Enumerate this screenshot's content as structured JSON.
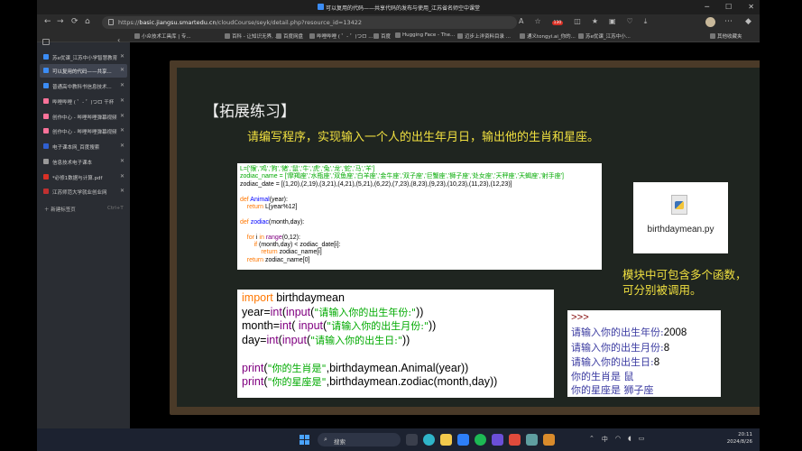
{
  "window": {
    "title": "可以复用的代码——共享代码的发布与使用_江苏省名师空中课堂",
    "controls": [
      "─",
      "☐",
      "✕"
    ]
  },
  "address_bar": {
    "url_prefix": "https://",
    "url_host": "basic.jiangsu.smartedu.cn",
    "url_path": "/cloudCourse/seyk/detail.php?resource_id=13422",
    "badge_count": "130",
    "nav": [
      "←",
      "→",
      "⟳",
      "⌂"
    ]
  },
  "bookmarks": [
    {
      "label": "小众技术工具库 | 专..."
    },
    {
      "label": "百科 - 让知识无界, ..."
    },
    {
      "label": "百度网盘"
    },
    {
      "label": "哔哩哔哩 ( ゜- ゜)つロ ..."
    },
    {
      "label": "百度"
    },
    {
      "label": "Hugging Face - The..."
    },
    {
      "label": "迈步上洋资料目录 ..."
    },
    {
      "label": "通义tongyi.ai_你的..."
    },
    {
      "label": "苏e优课_江苏中小..."
    },
    {
      "label": "其他收藏夹"
    }
  ],
  "sidebar": {
    "tabs": [
      {
        "label": "苏e优课_江苏中小学智慧教育",
        "active": false
      },
      {
        "label": "可以复用的代码——共享...",
        "active": true
      },
      {
        "label": "普通高中教科书信息技术...",
        "active": false
      },
      {
        "label": "哔哩哔哩 ( ゜- ゜)つロ 干杯",
        "active": false
      },
      {
        "label": "创作中心 - 哔哩哔哩弹幕视频",
        "active": false
      },
      {
        "label": "创作中心 - 哔哩哔哩弹幕视频",
        "active": false
      },
      {
        "label": "电子课本网_百度搜索",
        "active": false
      },
      {
        "label": "信息技术电子课本",
        "active": false
      },
      {
        "label": "*必修1数据与计算.pdf",
        "active": false
      },
      {
        "label": "江苏师范大学就业创业网",
        "active": false
      }
    ],
    "new_tab_label": "新建标签页",
    "new_tab_shortcut": "Ctrl+T"
  },
  "slide": {
    "heading": "【拓展练习】",
    "task": "请编写程序，实现输入一个人的出生年月日，输出他的生肖和星座。",
    "code_top": {
      "line1": "L=['猴','鸡','狗','猪','鼠','牛','虎','兔','龙','蛇','马','羊']",
      "line2": "zodiac_name = ['摩羯座','水瓶座','双鱼座','白羊座','金牛座','双子座','巨蟹座','狮子座','处女座','天秤座','天蝎座','射手座']",
      "line3": "zodiac_date = [(1,20),(2,19),(3,21),(4,21),(5,21),(6,22),(7,23),(8,23),(9,23),(10,23),(11,23),(12,23)]",
      "def1_kw": "def ",
      "def1_name": "Animal",
      "def1_rest": "(year):",
      "ret1_kw": "return ",
      "ret1_rest": "L[year%12]",
      "def2_kw": "def ",
      "def2_name": "zodiac",
      "def2_rest": "(month,day):",
      "for_kw": "for ",
      "for_mid": "i ",
      "in_kw": "in ",
      "range_fn": "range",
      "for_rest": "(0,12):",
      "if_kw": "if ",
      "if_rest": "(month,day) < zodiac_date[i]:",
      "ret2_kw": "return ",
      "ret2_rest": "zodiac_name[i]",
      "ret3_kw": "return ",
      "ret3_rest": "zodiac_name[0]"
    },
    "file_card": {
      "name": "birthdaymean.py"
    },
    "note_line1": "模块中可包含多个函数，",
    "note_line2": "可分别被调用。",
    "code_bottom": {
      "l1_kw": "import",
      "l1_rest": " birthdaymean",
      "l2_a": "year=",
      "l2_int": "int",
      "l2_b": "(",
      "l2_input": "input",
      "l2_c": "(",
      "l2_str": "\"请输入你的出生年份:\"",
      "l2_d": "))",
      "l3_a": "month=",
      "l3_int": "int",
      "l3_b": "( ",
      "l3_input": "input",
      "l3_c": "(",
      "l3_str": "\"请输入你的出生月份:\"",
      "l3_d": "))",
      "l4_a": "day=",
      "l4_int": "int",
      "l4_b": "(",
      "l4_input": "input",
      "l4_c": "(",
      "l4_str": "\"请输入你的出生日:\"",
      "l4_d": "))",
      "l5_print": "print",
      "l5_a": "(",
      "l5_str": "\"你的生肖是\"",
      "l5_b": ",birthdaymean.Animal(year))",
      "l6_print": "print",
      "l6_a": "(",
      "l6_str": "\"你的星座是\"",
      "l6_b": ",birthdaymean.zodiac(month,day))"
    },
    "shell": {
      "prompt": ">>>",
      "q1": "请输入你的出生年份:",
      "a1": "2008",
      "q2": "请输入你的出生月份:",
      "a2": "8",
      "q3": "请输入你的出生日:",
      "a3": "8",
      "r1": "你的生肖是 鼠",
      "r2": "你的星座是 狮子座"
    }
  },
  "taskbar": {
    "search_label": "搜索",
    "time": "20:11",
    "date": "2024/8/26"
  },
  "colors": {
    "board_bg": "#1f2520",
    "board_frame": "#4a3a28",
    "heading": "#f0f0f0",
    "task_text": "#f0e040",
    "keyword": "#ff7700",
    "builtin": "#800080",
    "string": "#00aa00"
  }
}
